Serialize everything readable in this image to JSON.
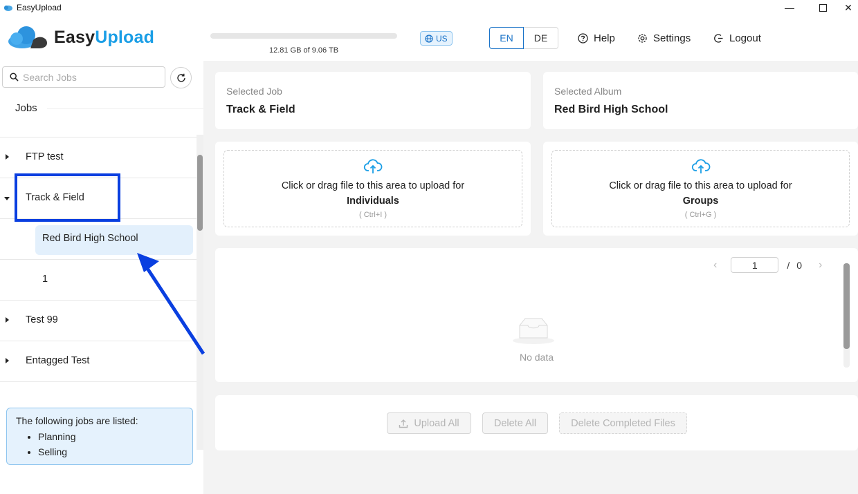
{
  "window": {
    "title": "EasyUpload"
  },
  "header": {
    "logo_easy": "Easy",
    "logo_upload": "Upload",
    "storage_label": "12.81 GB of 9.06 TB",
    "storage_used_fraction": 0.0,
    "region": "US",
    "languages": [
      "EN",
      "DE"
    ],
    "active_language": "EN",
    "help": "Help",
    "settings": "Settings",
    "logout": "Logout"
  },
  "sidebar": {
    "search_placeholder": "Search Jobs",
    "jobs_heading": "Jobs",
    "tree": [
      {
        "label": "FTP test",
        "expanded": false
      },
      {
        "label": "Track & Field",
        "expanded": true
      },
      {
        "label": "Red Bird High School",
        "selected": true
      },
      {
        "label": "1"
      },
      {
        "label": "Test 99",
        "expanded": false
      },
      {
        "label": "Entagged Test",
        "expanded": false
      }
    ],
    "info_text": "The following jobs are listed:",
    "info_items": [
      "Planning",
      "Selling"
    ]
  },
  "main": {
    "selected_job_caption": "Selected Job",
    "selected_job": "Track & Field",
    "selected_album_caption": "Selected Album",
    "selected_album": "Red Bird High School",
    "upload_individuals": {
      "text": "Click or drag file to this area to upload for",
      "target": "Individuals",
      "shortcut": "( Ctrl+I )"
    },
    "upload_groups": {
      "text": "Click or drag file to this area to upload for",
      "target": "Groups",
      "shortcut": "( Ctrl+G )"
    },
    "pager": {
      "current": "1",
      "separator": "/",
      "total": "0"
    },
    "no_data": "No data",
    "buttons": {
      "upload_all": "Upload All",
      "delete_all": "Delete All",
      "delete_completed": "Delete Completed Files"
    }
  },
  "colors": {
    "accent": "#1a73c8",
    "brand": "#1a9ee6",
    "annotation": "#0a3fe0"
  }
}
